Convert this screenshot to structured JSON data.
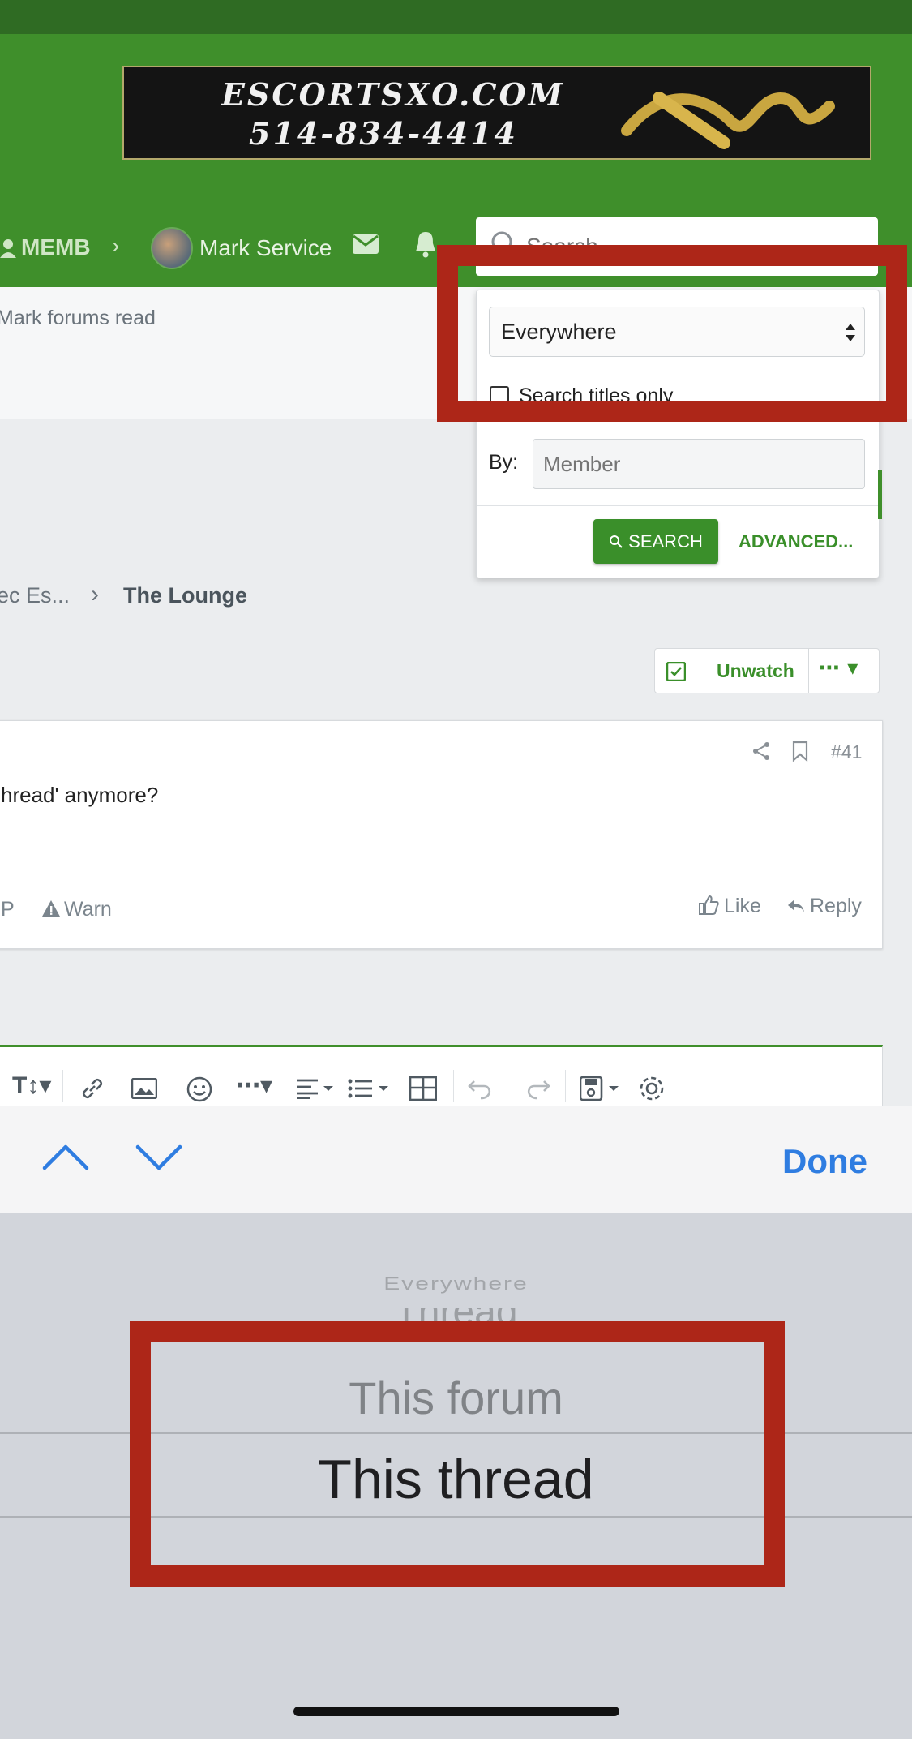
{
  "banner": {
    "line1": "ESCORTSXO.COM",
    "line2": "514-834-4414"
  },
  "nav": {
    "members_label": "MEMB",
    "user_name": "Mark Service",
    "search_placeholder": "Search..."
  },
  "subnav": {
    "mark_read": "Mark forums read"
  },
  "search_dropdown": {
    "scope_value": "Everywhere",
    "titles_only_label": "Search titles only",
    "by_label": "By:",
    "member_placeholder": "Member",
    "search_button": "SEARCH",
    "advanced_button": "ADVANCED..."
  },
  "breadcrumb": {
    "parent": "ec Es...",
    "current": "The Lounge"
  },
  "thread_actions": {
    "unwatch": "Unwatch"
  },
  "post": {
    "number": "#41",
    "body": "hread' anymore?",
    "ip_label": "P",
    "warn": "Warn",
    "like": "Like",
    "reply": "Reply"
  },
  "keyboard_bar": {
    "done": "Done"
  },
  "picker": {
    "options": [
      "Everywhere",
      "Thread",
      "This forum",
      "This thread"
    ],
    "selected": "This thread"
  },
  "colors": {
    "header_green": "#3f8f2b",
    "accent_green": "#3a8f2a",
    "highlight_red": "#ad2618",
    "ios_blue": "#2f7de1"
  }
}
